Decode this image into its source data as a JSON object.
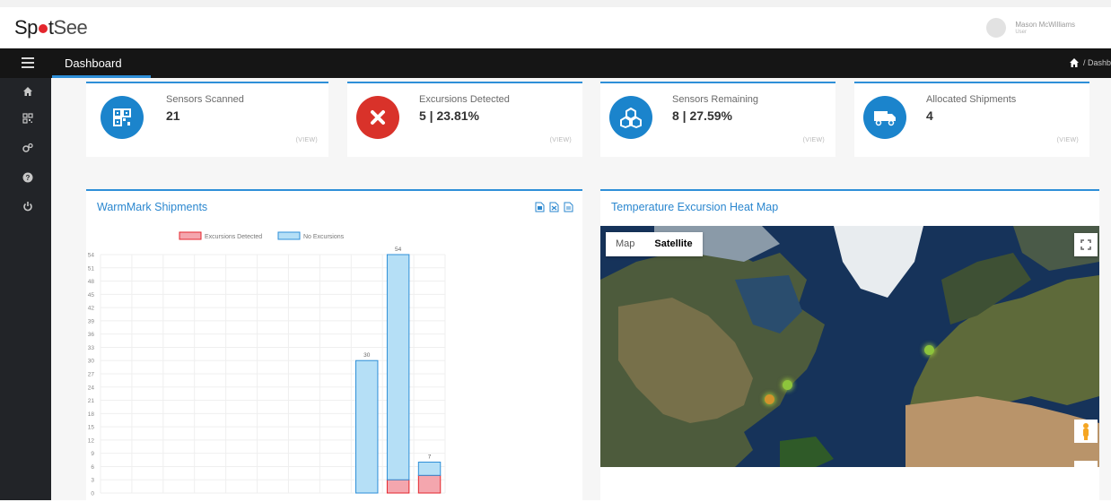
{
  "app": {
    "logo_part1": "Sp",
    "logo_part2": "t",
    "logo_part3": "See",
    "user_name": "Mason McWilliams",
    "user_role": "User"
  },
  "nav": {
    "title": "Dashboard",
    "breadcrumb": "/ Dashb"
  },
  "sidebar": {
    "items": [
      {
        "icon": "home-icon"
      },
      {
        "icon": "qr-code-icon"
      },
      {
        "icon": "gears-icon"
      },
      {
        "icon": "help-icon"
      },
      {
        "icon": "power-icon"
      }
    ]
  },
  "stats": [
    {
      "label": "Sensors Scanned",
      "value": "21",
      "view": "(VIEW)",
      "color": "#1b84cc",
      "icon": "qr-code-icon"
    },
    {
      "label": "Excursions Detected",
      "value": "5 | 23.81%",
      "view": "(VIEW)",
      "color": "#d9322a",
      "icon": "x-icon"
    },
    {
      "label": "Sensors Remaining",
      "value": "8 | 27.59%",
      "view": "(VIEW)",
      "color": "#1b84cc",
      "icon": "cubes-icon"
    },
    {
      "label": "Allocated Shipments",
      "value": "4",
      "view": "(VIEW)",
      "color": "#1b84cc",
      "icon": "truck-icon"
    }
  ],
  "shipments_panel": {
    "title": "WarmMark Shipments",
    "icons": [
      "pdf-icon",
      "excel-icon",
      "csv-icon"
    ]
  },
  "map_panel": {
    "title": "Temperature Excursion Heat Map",
    "map_button": "Map",
    "satellite_button": "Satellite",
    "zoom_in": "+"
  },
  "chart_data": {
    "type": "bar",
    "title": "",
    "xlabel": "",
    "ylabel": "",
    "ylim": [
      0,
      54
    ],
    "y_ticks": [
      0,
      3,
      6,
      9,
      12,
      15,
      18,
      21,
      24,
      27,
      30,
      33,
      36,
      39,
      42,
      45,
      48,
      51,
      54
    ],
    "legend_position": "top",
    "grid": true,
    "categories": [
      "",
      "",
      "",
      "",
      "",
      "",
      "",
      "",
      "",
      "",
      ""
    ],
    "series": [
      {
        "name": "Excursions Detected",
        "color": "#f4a6ae",
        "stroke": "#e4262d",
        "values": [
          0,
          0,
          0,
          0,
          0,
          0,
          0,
          0,
          0,
          3,
          4
        ]
      },
      {
        "name": "No Excursions",
        "color": "#b5dff6",
        "stroke": "#2e8fd8",
        "values": [
          0,
          0,
          0,
          0,
          0,
          0,
          0,
          0,
          30,
          51,
          3
        ]
      }
    ],
    "data_labels": [
      "",
      "",
      "",
      "",
      "",
      "",
      "",
      "",
      "30",
      "54",
      "7"
    ]
  }
}
